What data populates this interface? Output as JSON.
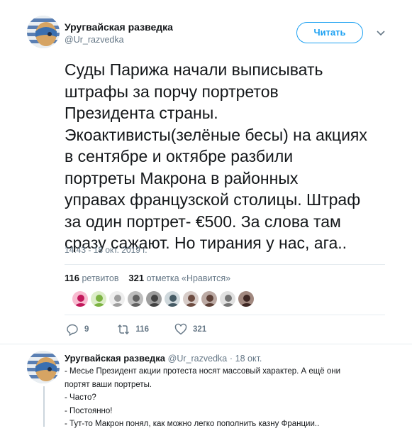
{
  "tweet": {
    "author_name": "Уругвайская разведка",
    "author_handle": "@Ur_razvedka",
    "follow_label": "Читать",
    "text": "Суды Парижа начали выписывать\nштрафы за порчу портретов\nПрезидента страны.\nЭкоактивисты(зелёные бесы) на акциях\nв сентябре и октябре разбили\nпортреты Макрона в районных\nуправах французской столицы. Штраф\nза один портрет- €500. За слова там\nсразу сажают. Но тирания у нас, ага..",
    "timestamp": "14:43 - 18 окт. 2019 г.",
    "retweets_count": "116",
    "retweets_label": "ретвитов",
    "likes_count": "321",
    "likes_label": "отметка «Нравится»",
    "likers": [
      "liker-avatar",
      "liker-avatar",
      "liker-avatar",
      "liker-avatar",
      "liker-avatar",
      "liker-avatar",
      "liker-avatar",
      "liker-avatar",
      "liker-avatar",
      "liker-avatar"
    ],
    "actions": {
      "reply_count": "9",
      "retweet_count": "116",
      "like_count": "321"
    }
  },
  "reply": {
    "author_name": "Уругвайская разведка",
    "author_handle": "@Ur_razvedka",
    "separator": "·",
    "date": "18 окт.",
    "lines": [
      "- Месье Президент акции протеста носят массовый характер. А ещё они",
      "портят ваши портреты.",
      "- Часто?",
      "- Постоянно!",
      "- Тут-то Макрон понял, как можно легко пополнить казну Франции.."
    ]
  },
  "colors": {
    "accent": "#1da1f2",
    "secondary_text": "#657786",
    "divider": "#e6ecf0"
  }
}
